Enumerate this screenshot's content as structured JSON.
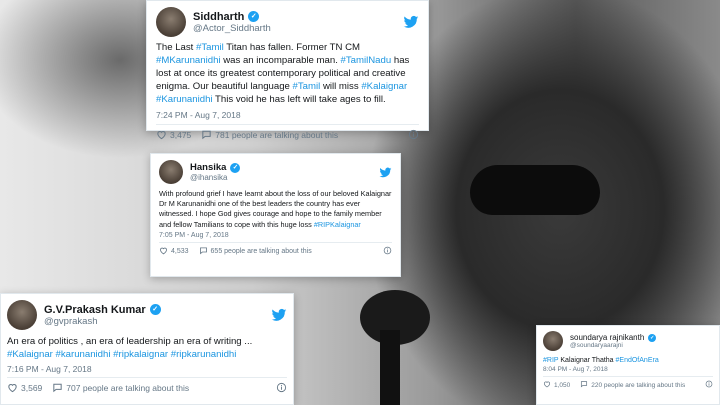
{
  "tweets": [
    {
      "name": "Siddharth",
      "handle": "@Actor_Siddharth",
      "body": [
        {
          "t": "The Last ",
          "tag": false
        },
        {
          "t": "#Tamil",
          "tag": true
        },
        {
          "t": " Titan has fallen. Former TN CM ",
          "tag": false
        },
        {
          "t": "#MKarunanidhi",
          "tag": true
        },
        {
          "t": " was an incomparable man. ",
          "tag": false
        },
        {
          "t": "#TamilNadu",
          "tag": true
        },
        {
          "t": " has lost at once its greatest contemporary political and creative enigma. Our beautiful language ",
          "tag": false
        },
        {
          "t": "#Tamil",
          "tag": true
        },
        {
          "t": " will miss ",
          "tag": false
        },
        {
          "t": "#Kalaignar",
          "tag": true
        },
        {
          "t": " ",
          "tag": false
        },
        {
          "t": "#Karunanidhi",
          "tag": true
        },
        {
          "t": " This void he has left will take ages to fill.",
          "tag": false
        }
      ],
      "time": "7:24 PM - Aug 7, 2018",
      "likes": "3,475",
      "talking": "781 people are talking about this"
    },
    {
      "name": "Hansika",
      "handle": "@ihansika",
      "body": [
        {
          "t": "With profound grief I have learnt about the loss of our beloved Kalaignar Dr M Karunanidhi one of the best leaders the country has ever witnessed. I hope God gives courage and hope to the family member and fellow Tamilians to cope with this huge loss ",
          "tag": false
        },
        {
          "t": "#RIPKalaignar",
          "tag": true
        }
      ],
      "time": "7:05 PM - Aug 7, 2018",
      "likes": "4,533",
      "talking": "655 people are talking about this"
    },
    {
      "name": "G.V.Prakash Kumar",
      "handle": "@gvprakash",
      "body": [
        {
          "t": "An era of politics , an era of leadership an era of writing ... ",
          "tag": false
        },
        {
          "t": "#Kalaignar",
          "tag": true
        },
        {
          "t": " ",
          "tag": false
        },
        {
          "t": "#karunanidhi",
          "tag": true
        },
        {
          "t": " ",
          "tag": false
        },
        {
          "t": "#ripkalaignar",
          "tag": true
        },
        {
          "t": " ",
          "tag": false
        },
        {
          "t": "#ripkarunanidhi",
          "tag": true
        }
      ],
      "time": "7:16 PM - Aug 7, 2018",
      "likes": "3,569",
      "talking": "707 people are talking about this"
    },
    {
      "name": "soundarya rajnikanth",
      "handle": "@soundaryaarajni",
      "body": [
        {
          "t": "#RIP",
          "tag": true
        },
        {
          "t": " Kalaignar Thatha ",
          "tag": false
        },
        {
          "t": "#EndOfAnEra",
          "tag": true
        }
      ],
      "time": "8:04 PM - Aug 7, 2018",
      "likes": "1,050",
      "talking": "220 people are talking about this"
    }
  ],
  "colors": {
    "link": "#1b95e0",
    "twitter_blue": "#1da1f2",
    "muted": "#657786"
  },
  "icons": [
    "twitter-bird-icon",
    "verified-badge-icon",
    "heart-icon",
    "speech-bubble-icon",
    "info-icon"
  ]
}
